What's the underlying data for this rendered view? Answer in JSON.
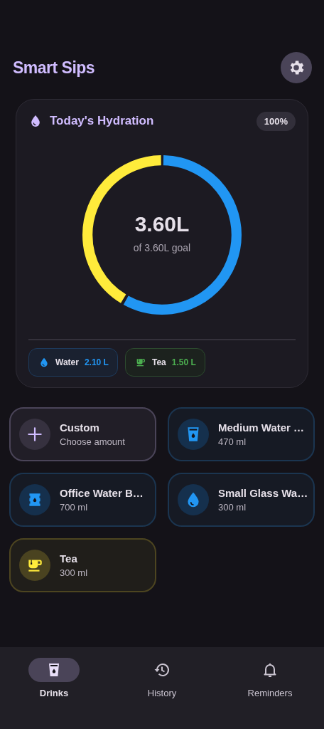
{
  "app_bar": {
    "title": "Smart Sips"
  },
  "summary": {
    "title": "Today's Hydration",
    "percent": "100%",
    "total": "3.60L",
    "caption": "of 3.60L goal",
    "segments": [
      {
        "color": "#2196f3",
        "level": 0.583
      },
      {
        "color": "#ffeb3b",
        "level": 0.417
      }
    ],
    "chips": [
      {
        "kind": "water",
        "label": "Water",
        "amount": "2.10 L"
      },
      {
        "kind": "tea",
        "label": "Tea",
        "amount": "1.50 L"
      }
    ]
  },
  "drinks": [
    {
      "kind": "custom",
      "name": "Custom",
      "detail": "Choose amount"
    },
    {
      "kind": "glass",
      "name": "Medium Water …",
      "detail": "470 ml"
    },
    {
      "kind": "bottle",
      "name": "Office Water B…",
      "detail": "700 ml"
    },
    {
      "kind": "drop",
      "name": "Small Glass Wa…",
      "detail": "300 ml"
    },
    {
      "kind": "tea",
      "name": "Tea",
      "detail": "300 ml"
    }
  ],
  "nav": [
    {
      "kind": "drinks",
      "label": "Drinks",
      "selected": true
    },
    {
      "kind": "history",
      "label": "History",
      "selected": false
    },
    {
      "kind": "reminders",
      "label": "Reminders",
      "selected": false
    }
  ]
}
